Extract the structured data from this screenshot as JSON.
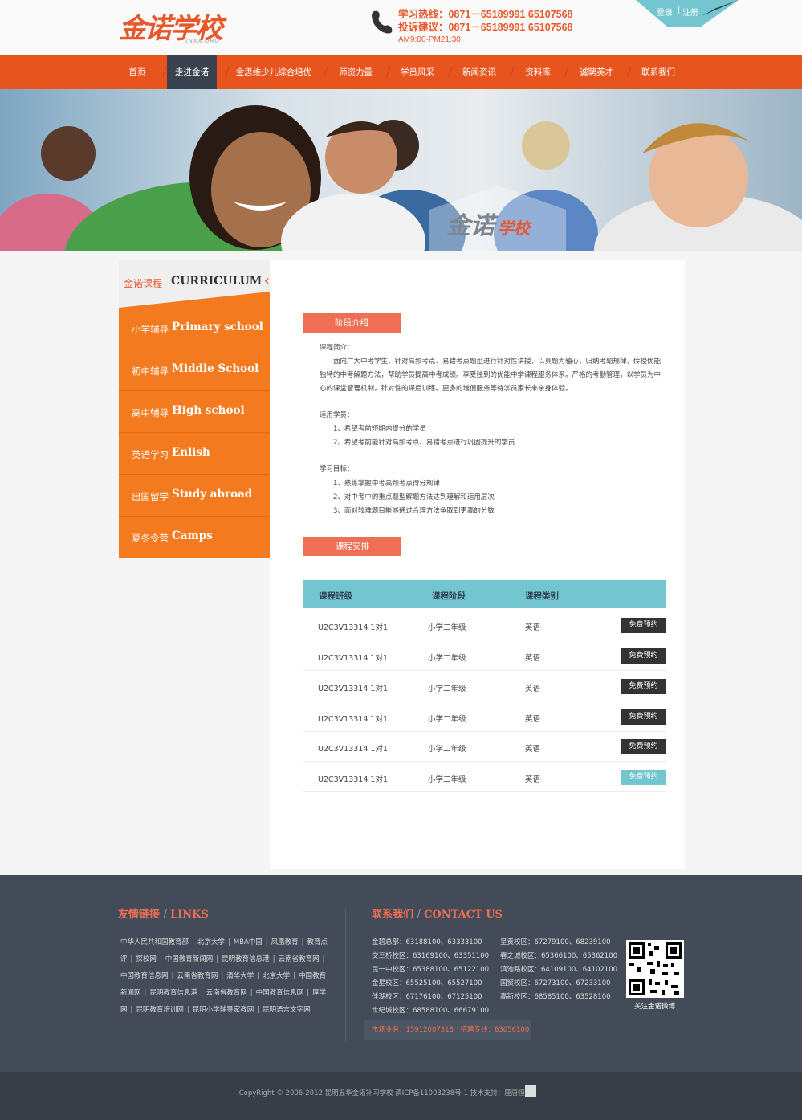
{
  "header": {
    "logo_text": "金诺学校",
    "logo_domain": "JNXX.ORG",
    "hotline_line1": "学习热线：0871－65189991 65107568",
    "hotline_line2": "投诉建议：0871－65189991 65107568",
    "hours": "AM9:00-PM21:30",
    "login": "登录",
    "register": "注册"
  },
  "nav": {
    "items": [
      "首页",
      "走进金诺",
      "金思维少儿综合培优",
      "师资力量",
      "学员风采",
      "新闻资讯",
      "资料库",
      "诚聘英才",
      "联系我们"
    ],
    "active_index": 1
  },
  "sidebar": {
    "title_cn": "金诺课程",
    "title_en": "CURRICULUM",
    "items": [
      {
        "cn": "小学辅导",
        "en": "Primary school"
      },
      {
        "cn": "初中辅导",
        "en": "Middle School"
      },
      {
        "cn": "高中辅导",
        "en": "High school"
      },
      {
        "cn": "英语学习",
        "en": "Enlish"
      },
      {
        "cn": "出国留学",
        "en": "Study abroad"
      },
      {
        "cn": "夏冬令营",
        "en": "Camps"
      }
    ],
    "active_index": 1
  },
  "main": {
    "stage_tag": "阶段介绍",
    "intro_label": "课程简介：",
    "intro_text": "面向广大中考学生，针对高频考点、易错考点题型进行针对性讲授，以真题为轴心，归纳考题规律，传授优能独特的中考解题方法，帮助学员提高中考成绩。享受独到的优能中学课程服务体系。严格的考勤管理，以学员为中心的课堂管理机制，针对性的课后训练。更多的增值服务等待学员家长来亲身体验。",
    "audience_label": "适用学员：",
    "audience": [
      "1、希望考前短期内提分的学员",
      "2、希望考前能针对高频考点、易错考点进行巩固提升的学员"
    ],
    "goal_label": "学习目标：",
    "goals": [
      "1、熟练掌握中考高频考点得分规律",
      "2、对中考中的重点题型解题方法达到理解和运用层次",
      "3、面对较难题目能够通过合理方法争取到更高的分数"
    ],
    "schedule_tag": "课程安排",
    "table": {
      "headers": [
        "课程班级",
        "课程阶段",
        "课程类别"
      ],
      "rows": [
        {
          "class": "U2C3V13314 1对1",
          "stage": "小学二年级",
          "type": "英语",
          "btn": "免费预约"
        },
        {
          "class": "U2C3V13314 1对1",
          "stage": "小学二年级",
          "type": "英语",
          "btn": "免费预约"
        },
        {
          "class": "U2C3V13314 1对1",
          "stage": "小学二年级",
          "type": "英语",
          "btn": "免费预约"
        },
        {
          "class": "U2C3V13314 1对1",
          "stage": "小学二年级",
          "type": "英语",
          "btn": "免费预约"
        },
        {
          "class": "U2C3V13314 1对1",
          "stage": "小学二年级",
          "type": "英语",
          "btn": "免费预约"
        },
        {
          "class": "U2C3V13314 1对1",
          "stage": "小学二年级",
          "type": "英语",
          "btn": "免费预约"
        }
      ]
    }
  },
  "footer": {
    "links_title_cn": "友情链接",
    "links_title_en": "LINKS",
    "links": [
      "中华人民共和国教育部",
      "北京大学",
      "MBA中国",
      "凤凰教育",
      "教育点评",
      "探校网",
      "中国教育新闻网",
      "昆明教育信息港",
      "云南省教育网",
      "中国教育信息网",
      "云南省教育网",
      "清华大学",
      "北京大学",
      "中国教育新闻网",
      "昆明教育信息港",
      "云南省教育网",
      "中国教育信息网",
      "厚学网",
      "昆明教育培训网",
      "昆明小学辅导家教网",
      "昆明语言文字网"
    ],
    "contact_title_cn": "联系我们",
    "contact_title_en": "CONTACT US",
    "contact_left": [
      "金碧总部：63188100、63333100",
      "交三桥校区：63169100、63351100",
      "昆一中校区：65388100、65122100",
      "金星校区：65525100、65527100",
      "佳湖校区：67176100、67125100",
      "世纪城校区：68588100、66679100"
    ],
    "contact_right": [
      "呈贡校区：67279100、68239100",
      "春之城校区：65366100、65362100",
      "滇池路校区：64109100、64102100",
      "国贸校区：67273100、67233100",
      "高新校区：68585100、63528100"
    ],
    "hotbox": "市场业务：15912007318　招聘专线：63056100",
    "qr_caption": "关注金诺微博",
    "copyright": "CopyRight © 2006-2012  昆明五华金诺补习学校  滇ICP备11003238号-1  技术支持：厘唐恒基"
  }
}
